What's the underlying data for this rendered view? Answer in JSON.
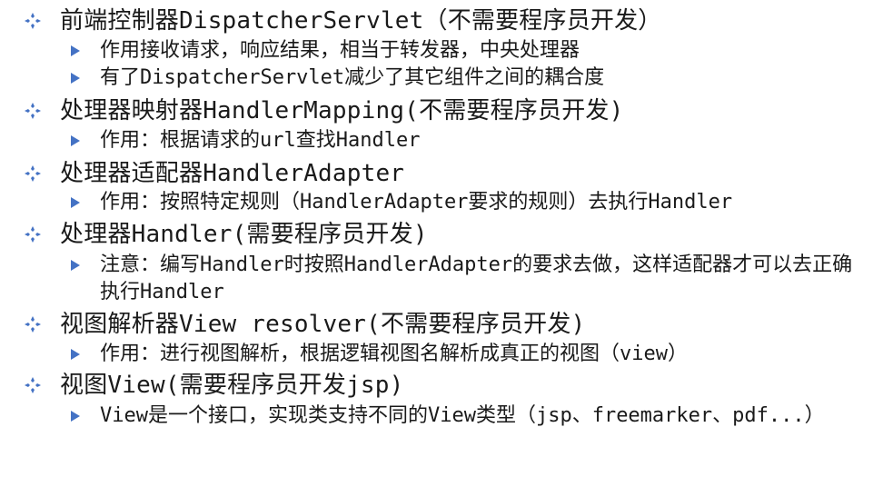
{
  "colors": {
    "text": "#1a1a1a",
    "bullet_primary": "#4472c4",
    "bullet_secondary": "#4472c4"
  },
  "icons": {
    "level1": "four-diamond-bullet-icon",
    "level2": "triangle-right-bullet-icon"
  },
  "items": [
    {
      "title": "前端控制器DispatcherServlet（不需要程序员开发）",
      "subs": [
        "作用接收请求，响应结果，相当于转发器，中央处理器",
        "有了DispatcherServlet减少了其它组件之间的耦合度"
      ]
    },
    {
      "title": "处理器映射器HandlerMapping(不需要程序员开发)",
      "subs": [
        "作用：根据请求的url查找Handler"
      ]
    },
    {
      "title": "处理器适配器HandlerAdapter",
      "subs": [
        "作用：按照特定规则（HandlerAdapter要求的规则）去执行Handler"
      ]
    },
    {
      "title": "处理器Handler(需要程序员开发)",
      "subs": [
        "注意：编写Handler时按照HandlerAdapter的要求去做，这样适配器才可以去正确执行Handler"
      ]
    },
    {
      "title": "视图解析器View resolver(不需要程序员开发)",
      "subs": [
        "作用：进行视图解析，根据逻辑视图名解析成真正的视图（view）"
      ]
    },
    {
      "title": "视图View(需要程序员开发jsp)",
      "subs": [
        "View是一个接口，实现类支持不同的View类型（jsp、freemarker、pdf...）"
      ]
    }
  ]
}
